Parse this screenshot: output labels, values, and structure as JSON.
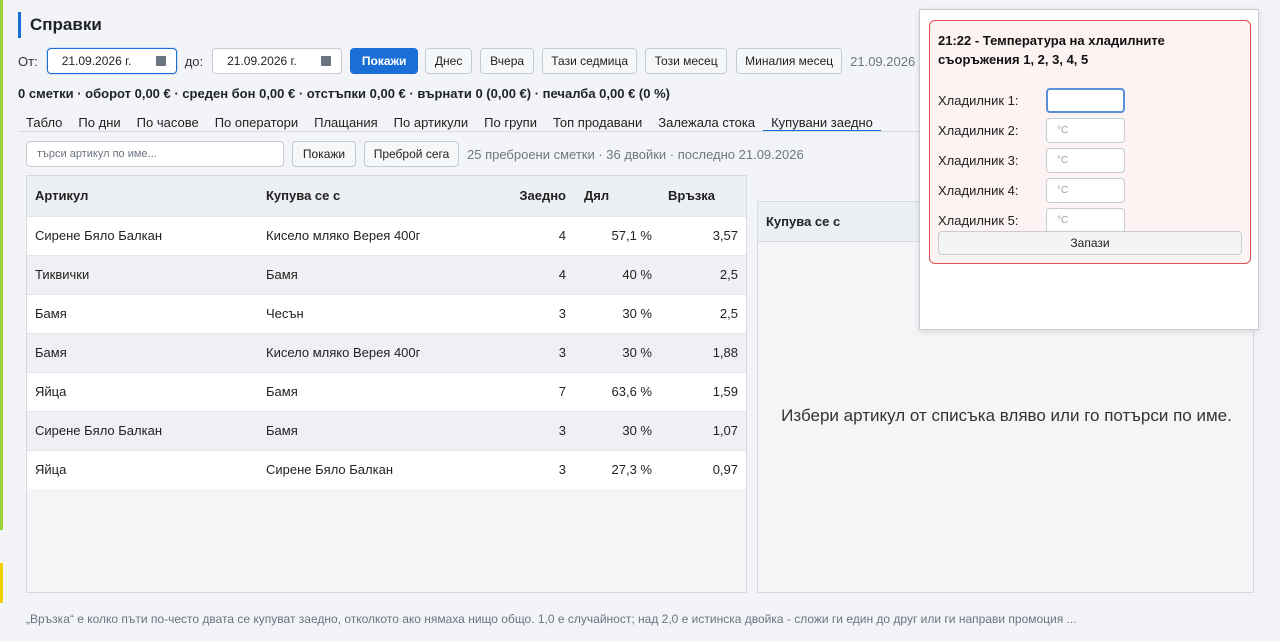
{
  "page": {
    "title": "Справки"
  },
  "filters": {
    "from_label": "От:",
    "from_value": "21.09.2026 г.",
    "to_label": "до:",
    "to_value": "21.09.2026 г.",
    "show_label": "Покажи",
    "quick": [
      "Днес",
      "Вчера",
      "Тази седмица",
      "Този месец",
      "Миналия месец"
    ],
    "current_date": "21.09.2026"
  },
  "summary": "0 сметки · оборот 0,00 € · среден бон 0,00 € · отстъпки 0,00 € · върнати 0 (0,00 €) · печалба 0,00 € (0 %)",
  "tabs": [
    "Табло",
    "По дни",
    "По часове",
    "По оператори",
    "Плащания",
    "По артикули",
    "По групи",
    "Топ продавани",
    "Залежала стока",
    "Купувани заедно"
  ],
  "active_tab": "Купувани заедно",
  "search": {
    "placeholder": "търси артикул по име...",
    "show_label": "Покажи",
    "count_label": "Преброй сега",
    "stats": "25 преброени сметки · 36 двойки · последно 21.09.2026"
  },
  "table": {
    "headers": [
      "Артикул",
      "Купува се с",
      "Заедно",
      "Дял",
      "Връзка"
    ],
    "rows": [
      [
        "Сирене Бяло Балкан",
        "Кисело мляко Верея 400г",
        "4",
        "57,1 %",
        "3,57"
      ],
      [
        "Тиквички",
        "Бамя",
        "4",
        "40 %",
        "2,5"
      ],
      [
        "Бамя",
        "Чесън",
        "3",
        "30 %",
        "2,5"
      ],
      [
        "Бамя",
        "Кисело мляко Верея 400г",
        "3",
        "30 %",
        "1,88"
      ],
      [
        "Яйца",
        "Бамя",
        "7",
        "63,6 %",
        "1,59"
      ],
      [
        "Сирене Бяло Балкан",
        "Бамя",
        "3",
        "30 %",
        "1,07"
      ],
      [
        "Яйца",
        "Сирене Бяло Балкан",
        "3",
        "27,3 %",
        "0,97"
      ]
    ]
  },
  "detail": {
    "header": "Купува се с",
    "empty_text": "Избери артикул от списъка вляво или го потърси по име."
  },
  "footnote": "„Връзка“ е колко пъти по-често двата се купуват заедно, отколкото ако нямаха нищо общо. 1,0 е случайност; над 2,0 е истинска двойка - сложи ги един до друг или ги направи промоция ...",
  "popup": {
    "title": "21:22 - Температура на хладилните съоръжения 1, 2, 3, 4, 5",
    "fridges": [
      {
        "label": "Хладилник 1:",
        "placeholder": ""
      },
      {
        "label": "Хладилник 2:",
        "placeholder": "°C"
      },
      {
        "label": "Хладилник 3:",
        "placeholder": "°C"
      },
      {
        "label": "Хладилник 4:",
        "placeholder": "°C"
      },
      {
        "label": "Хладилник 5:",
        "placeholder": "°C"
      }
    ],
    "save_label": "Запази"
  },
  "colors": {
    "accent": "#1a6fd6",
    "alert_border": "#d9534f",
    "alert_bg": "#fdf3f3"
  }
}
